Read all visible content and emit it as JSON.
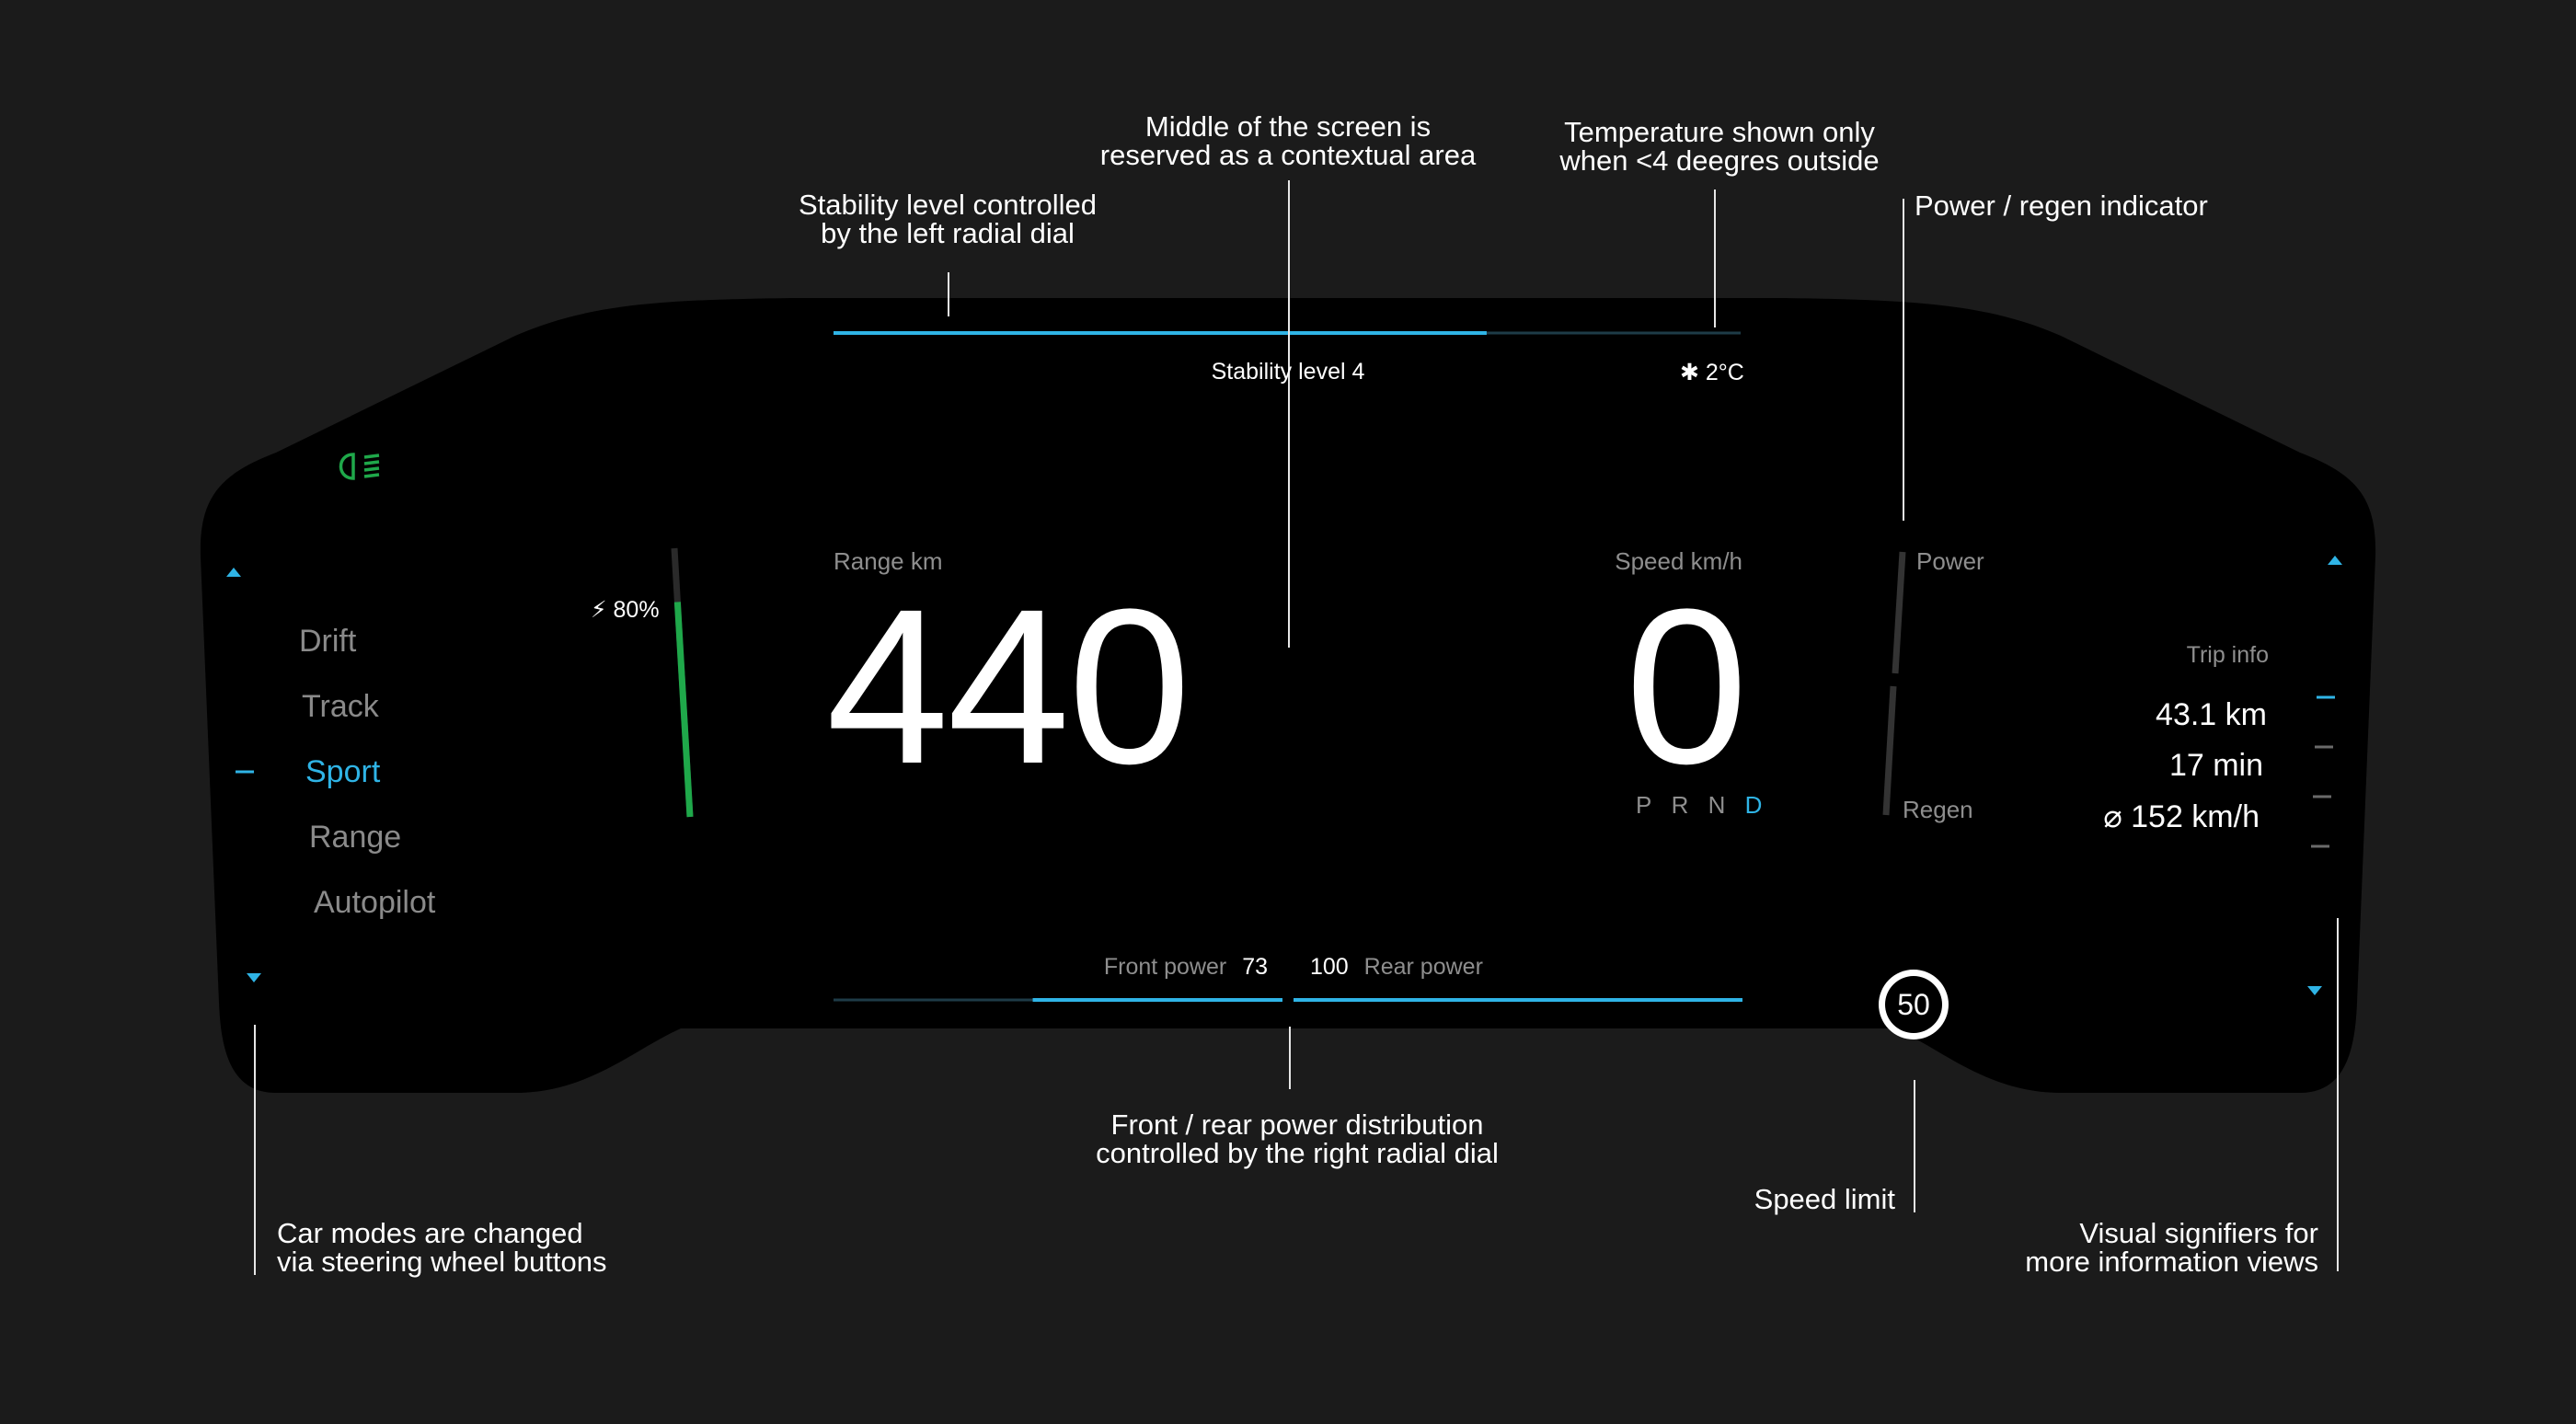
{
  "colors": {
    "background": "#1b1b1b",
    "cluster": "#000000",
    "accent_blue": "#2fb4e6",
    "battery_green": "#1fa84a",
    "annotation_line": "#e6e6e6"
  },
  "annotations": {
    "stability": [
      "Stability level controlled",
      "by the left radial dial"
    ],
    "middle": [
      "Middle of the screen is",
      "reserved as a contextual area"
    ],
    "temperature": [
      "Temperature shown only",
      "when <4 deegres outside"
    ],
    "power_regen": [
      "Power / regen indicator"
    ],
    "front_rear": [
      "Front / rear power distribution",
      "controlled by the right radial dial"
    ],
    "speed_limit": [
      "Speed limit"
    ],
    "car_modes": [
      "Car modes are changed",
      "via steering wheel buttons"
    ],
    "signifiers": [
      "Visual  signifiers for",
      "more information views"
    ]
  },
  "cluster": {
    "headlight_icon": "low-beam-headlight-icon",
    "stability": {
      "label": "Stability level 4",
      "level": 4,
      "fill_fraction": 0.72
    },
    "temperature": {
      "icon": "snowflake-icon",
      "value": "2°C"
    },
    "modes": {
      "items": [
        "Drift",
        "Track",
        "Sport",
        "Range",
        "Autopilot"
      ],
      "active": "Sport"
    },
    "battery": {
      "icon": "lightning-icon",
      "value": "80%",
      "fraction": 0.8
    },
    "range": {
      "label": "Range km",
      "value": "440"
    },
    "speed": {
      "label": "Speed km/h",
      "value": "0"
    },
    "gears": {
      "items": [
        "P",
        "R",
        "N",
        "D"
      ],
      "active": "D"
    },
    "power_meter": {
      "power_label": "Power",
      "regen_label": "Regen"
    },
    "trip": {
      "title": "Trip info",
      "distance": "43.1 km",
      "time": "17 min",
      "avg_speed": "⌀ 152 km/h"
    },
    "power_split": {
      "front_label": "Front power",
      "front_value": "73",
      "rear_value": "100",
      "rear_label": "Rear power"
    },
    "speed_limit": "50"
  }
}
